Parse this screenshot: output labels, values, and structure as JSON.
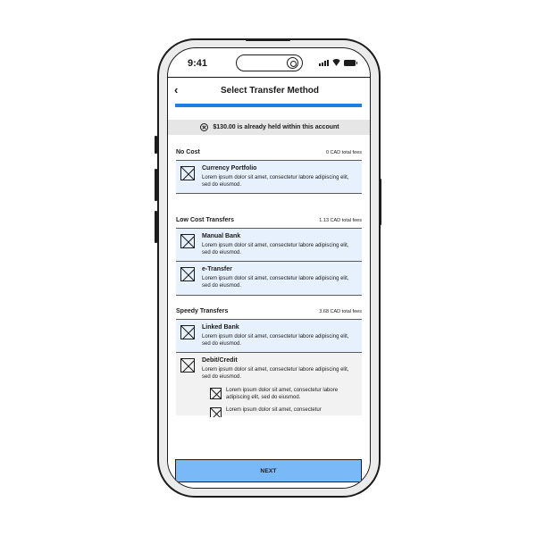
{
  "status_bar": {
    "time": "9:41"
  },
  "header": {
    "back_glyph": "‹",
    "title": "Select Transfer Method"
  },
  "progress": {
    "fraction": 1.0
  },
  "notice": {
    "icon": "x-circle-icon",
    "text": "$130.00 is already held within this account"
  },
  "sections": [
    {
      "title": "No Cost",
      "fees": "0 CAD total fees",
      "options": [
        {
          "title": "Currency Portfolio",
          "desc": "Lorem ipsum dolor sit amet, consectetur labore adipiscing elit, sed do eiusmod."
        }
      ]
    },
    {
      "title": "Low Cost Transfers",
      "fees": "1.13 CAD total fees",
      "options": [
        {
          "title": "Manual Bank",
          "desc": "Lorem ipsum dolor sit amet, consectetur labore adipiscing elit, sed do eiusmod."
        },
        {
          "title": "e-Transfer",
          "desc": "Lorem ipsum dolor sit amet, consectetur labore adipiscing elit, sed do eiusmod."
        }
      ]
    },
    {
      "title": "Speedy Transfers",
      "fees": "3.68 CAD total fees",
      "options": [
        {
          "title": "Linked Bank",
          "desc": "Lorem ipsum dolor sit amet, consectetur labore adipiscing elit, sed do eiusmod."
        },
        {
          "title": "Debit/Credit",
          "desc": "Lorem ipsum dolor sit amet, consectetur labore adipiscing elit, sed do eiusmod.",
          "sub_items": [
            {
              "desc": "Lorem ipsum dolor sit amet, consectetur labore adipiscing elit, sed do eiusmod."
            },
            {
              "desc": "Lorem ipsum dolor sit amet, consectetur"
            }
          ]
        }
      ]
    }
  ],
  "footer": {
    "next_label": "NEXT"
  },
  "colors": {
    "accent": "#1b7fe3",
    "option_bg": "#e6f1fd",
    "button_bg": "#7ab9f7",
    "notice_bg": "#e6e6e6"
  }
}
